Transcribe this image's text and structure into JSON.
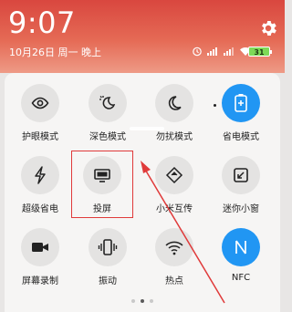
{
  "statusbar": {
    "time": "9:07",
    "date": "10月26日 周一 晚上",
    "battery": "31"
  },
  "tiles": [
    {
      "label": "护眼模式",
      "icon": "eye-icon",
      "active": false
    },
    {
      "label": "深色模式",
      "icon": "dark-mode-icon",
      "active": false
    },
    {
      "label": "勿扰模式",
      "icon": "moon-icon",
      "active": false
    },
    {
      "label": "省电模式",
      "icon": "battery-saver-icon",
      "active": true
    },
    {
      "label": "超级省电",
      "icon": "lightning-icon",
      "active": false
    },
    {
      "label": "投屏",
      "icon": "cast-screen-icon",
      "active": false
    },
    {
      "label": "小米互传",
      "icon": "share-arrow-icon",
      "active": false
    },
    {
      "label": "迷你小窗",
      "icon": "mini-window-icon",
      "active": false
    },
    {
      "label": "屏幕录制",
      "icon": "video-camera-icon",
      "active": false
    },
    {
      "label": "振动",
      "icon": "vibrate-icon",
      "active": false
    },
    {
      "label": "热点",
      "icon": "hotspot-icon",
      "active": false
    },
    {
      "label": "NFC",
      "icon": "nfc-icon",
      "active": true
    }
  ],
  "colors": {
    "header_red": "#d9473f",
    "active_blue": "#2196f3",
    "annotation_red": "#e03a3a"
  }
}
